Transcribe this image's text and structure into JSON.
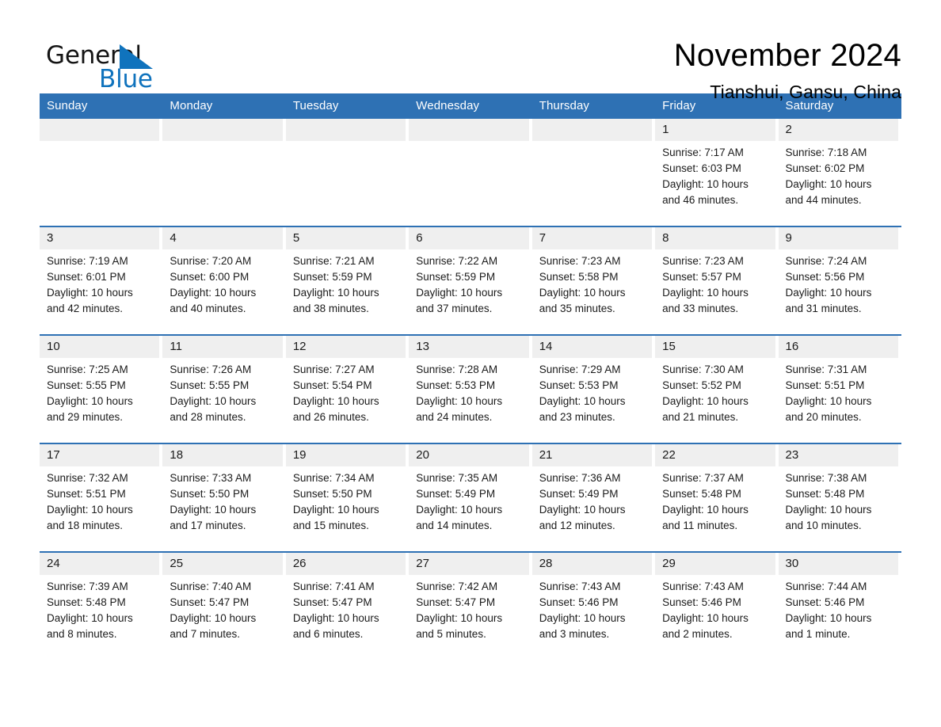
{
  "logo": {
    "word_one": "General",
    "word_two": "Blue",
    "triangle_color": "#1073bd"
  },
  "header": {
    "title": "November 2024",
    "location": "Tianshui, Gansu, China",
    "accent_color": "#2e71b4",
    "daynum_bg": "#efefef"
  },
  "weekdays": [
    "Sunday",
    "Monday",
    "Tuesday",
    "Wednesday",
    "Thursday",
    "Friday",
    "Saturday"
  ],
  "labels": {
    "sunrise_prefix": "Sunrise:",
    "sunset_prefix": "Sunset:",
    "daylight_prefix": "Daylight:"
  },
  "weeks": [
    [
      {
        "day": "",
        "sunrise": "",
        "sunset": "",
        "daylight_line1": "",
        "daylight_line2": ""
      },
      {
        "day": "",
        "sunrise": "",
        "sunset": "",
        "daylight_line1": "",
        "daylight_line2": ""
      },
      {
        "day": "",
        "sunrise": "",
        "sunset": "",
        "daylight_line1": "",
        "daylight_line2": ""
      },
      {
        "day": "",
        "sunrise": "",
        "sunset": "",
        "daylight_line1": "",
        "daylight_line2": ""
      },
      {
        "day": "",
        "sunrise": "",
        "sunset": "",
        "daylight_line1": "",
        "daylight_line2": ""
      },
      {
        "day": "1",
        "sunrise": "Sunrise: 7:17 AM",
        "sunset": "Sunset: 6:03 PM",
        "daylight_line1": "Daylight: 10 hours",
        "daylight_line2": "and 46 minutes."
      },
      {
        "day": "2",
        "sunrise": "Sunrise: 7:18 AM",
        "sunset": "Sunset: 6:02 PM",
        "daylight_line1": "Daylight: 10 hours",
        "daylight_line2": "and 44 minutes."
      }
    ],
    [
      {
        "day": "3",
        "sunrise": "Sunrise: 7:19 AM",
        "sunset": "Sunset: 6:01 PM",
        "daylight_line1": "Daylight: 10 hours",
        "daylight_line2": "and 42 minutes."
      },
      {
        "day": "4",
        "sunrise": "Sunrise: 7:20 AM",
        "sunset": "Sunset: 6:00 PM",
        "daylight_line1": "Daylight: 10 hours",
        "daylight_line2": "and 40 minutes."
      },
      {
        "day": "5",
        "sunrise": "Sunrise: 7:21 AM",
        "sunset": "Sunset: 5:59 PM",
        "daylight_line1": "Daylight: 10 hours",
        "daylight_line2": "and 38 minutes."
      },
      {
        "day": "6",
        "sunrise": "Sunrise: 7:22 AM",
        "sunset": "Sunset: 5:59 PM",
        "daylight_line1": "Daylight: 10 hours",
        "daylight_line2": "and 37 minutes."
      },
      {
        "day": "7",
        "sunrise": "Sunrise: 7:23 AM",
        "sunset": "Sunset: 5:58 PM",
        "daylight_line1": "Daylight: 10 hours",
        "daylight_line2": "and 35 minutes."
      },
      {
        "day": "8",
        "sunrise": "Sunrise: 7:23 AM",
        "sunset": "Sunset: 5:57 PM",
        "daylight_line1": "Daylight: 10 hours",
        "daylight_line2": "and 33 minutes."
      },
      {
        "day": "9",
        "sunrise": "Sunrise: 7:24 AM",
        "sunset": "Sunset: 5:56 PM",
        "daylight_line1": "Daylight: 10 hours",
        "daylight_line2": "and 31 minutes."
      }
    ],
    [
      {
        "day": "10",
        "sunrise": "Sunrise: 7:25 AM",
        "sunset": "Sunset: 5:55 PM",
        "daylight_line1": "Daylight: 10 hours",
        "daylight_line2": "and 29 minutes."
      },
      {
        "day": "11",
        "sunrise": "Sunrise: 7:26 AM",
        "sunset": "Sunset: 5:55 PM",
        "daylight_line1": "Daylight: 10 hours",
        "daylight_line2": "and 28 minutes."
      },
      {
        "day": "12",
        "sunrise": "Sunrise: 7:27 AM",
        "sunset": "Sunset: 5:54 PM",
        "daylight_line1": "Daylight: 10 hours",
        "daylight_line2": "and 26 minutes."
      },
      {
        "day": "13",
        "sunrise": "Sunrise: 7:28 AM",
        "sunset": "Sunset: 5:53 PM",
        "daylight_line1": "Daylight: 10 hours",
        "daylight_line2": "and 24 minutes."
      },
      {
        "day": "14",
        "sunrise": "Sunrise: 7:29 AM",
        "sunset": "Sunset: 5:53 PM",
        "daylight_line1": "Daylight: 10 hours",
        "daylight_line2": "and 23 minutes."
      },
      {
        "day": "15",
        "sunrise": "Sunrise: 7:30 AM",
        "sunset": "Sunset: 5:52 PM",
        "daylight_line1": "Daylight: 10 hours",
        "daylight_line2": "and 21 minutes."
      },
      {
        "day": "16",
        "sunrise": "Sunrise: 7:31 AM",
        "sunset": "Sunset: 5:51 PM",
        "daylight_line1": "Daylight: 10 hours",
        "daylight_line2": "and 20 minutes."
      }
    ],
    [
      {
        "day": "17",
        "sunrise": "Sunrise: 7:32 AM",
        "sunset": "Sunset: 5:51 PM",
        "daylight_line1": "Daylight: 10 hours",
        "daylight_line2": "and 18 minutes."
      },
      {
        "day": "18",
        "sunrise": "Sunrise: 7:33 AM",
        "sunset": "Sunset: 5:50 PM",
        "daylight_line1": "Daylight: 10 hours",
        "daylight_line2": "and 17 minutes."
      },
      {
        "day": "19",
        "sunrise": "Sunrise: 7:34 AM",
        "sunset": "Sunset: 5:50 PM",
        "daylight_line1": "Daylight: 10 hours",
        "daylight_line2": "and 15 minutes."
      },
      {
        "day": "20",
        "sunrise": "Sunrise: 7:35 AM",
        "sunset": "Sunset: 5:49 PM",
        "daylight_line1": "Daylight: 10 hours",
        "daylight_line2": "and 14 minutes."
      },
      {
        "day": "21",
        "sunrise": "Sunrise: 7:36 AM",
        "sunset": "Sunset: 5:49 PM",
        "daylight_line1": "Daylight: 10 hours",
        "daylight_line2": "and 12 minutes."
      },
      {
        "day": "22",
        "sunrise": "Sunrise: 7:37 AM",
        "sunset": "Sunset: 5:48 PM",
        "daylight_line1": "Daylight: 10 hours",
        "daylight_line2": "and 11 minutes."
      },
      {
        "day": "23",
        "sunrise": "Sunrise: 7:38 AM",
        "sunset": "Sunset: 5:48 PM",
        "daylight_line1": "Daylight: 10 hours",
        "daylight_line2": "and 10 minutes."
      }
    ],
    [
      {
        "day": "24",
        "sunrise": "Sunrise: 7:39 AM",
        "sunset": "Sunset: 5:48 PM",
        "daylight_line1": "Daylight: 10 hours",
        "daylight_line2": "and 8 minutes."
      },
      {
        "day": "25",
        "sunrise": "Sunrise: 7:40 AM",
        "sunset": "Sunset: 5:47 PM",
        "daylight_line1": "Daylight: 10 hours",
        "daylight_line2": "and 7 minutes."
      },
      {
        "day": "26",
        "sunrise": "Sunrise: 7:41 AM",
        "sunset": "Sunset: 5:47 PM",
        "daylight_line1": "Daylight: 10 hours",
        "daylight_line2": "and 6 minutes."
      },
      {
        "day": "27",
        "sunrise": "Sunrise: 7:42 AM",
        "sunset": "Sunset: 5:47 PM",
        "daylight_line1": "Daylight: 10 hours",
        "daylight_line2": "and 5 minutes."
      },
      {
        "day": "28",
        "sunrise": "Sunrise: 7:43 AM",
        "sunset": "Sunset: 5:46 PM",
        "daylight_line1": "Daylight: 10 hours",
        "daylight_line2": "and 3 minutes."
      },
      {
        "day": "29",
        "sunrise": "Sunrise: 7:43 AM",
        "sunset": "Sunset: 5:46 PM",
        "daylight_line1": "Daylight: 10 hours",
        "daylight_line2": "and 2 minutes."
      },
      {
        "day": "30",
        "sunrise": "Sunrise: 7:44 AM",
        "sunset": "Sunset: 5:46 PM",
        "daylight_line1": "Daylight: 10 hours",
        "daylight_line2": "and 1 minute."
      }
    ]
  ]
}
